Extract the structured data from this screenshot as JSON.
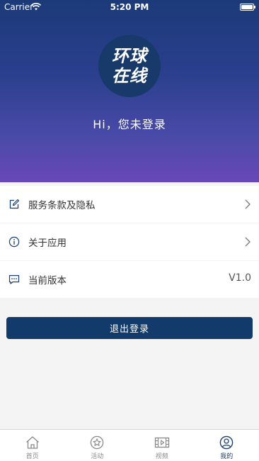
{
  "status_bar": {
    "carrier": "Carrier",
    "time": "5:20 PM"
  },
  "header": {
    "logo_line1": "环球",
    "logo_line2": "在线",
    "greeting": "Hi，您未登录"
  },
  "menu": {
    "terms_label": "服务条款及隐私",
    "about_label": "关于应用",
    "version_label": "当前版本",
    "version_value": "V1.0"
  },
  "logout_label": "退出登录",
  "tabbar": {
    "tabs": [
      {
        "label": "首页",
        "icon": "home-icon"
      },
      {
        "label": "活动",
        "icon": "star-circle-icon"
      },
      {
        "label": "视频",
        "icon": "film-icon"
      },
      {
        "label": "我的",
        "icon": "user-circle-icon",
        "active": true
      }
    ]
  },
  "colors": {
    "accent": "#123a6a",
    "header_top": "#1c3a78",
    "header_bottom": "#6848b8",
    "tab_active": "#1a3f72"
  }
}
